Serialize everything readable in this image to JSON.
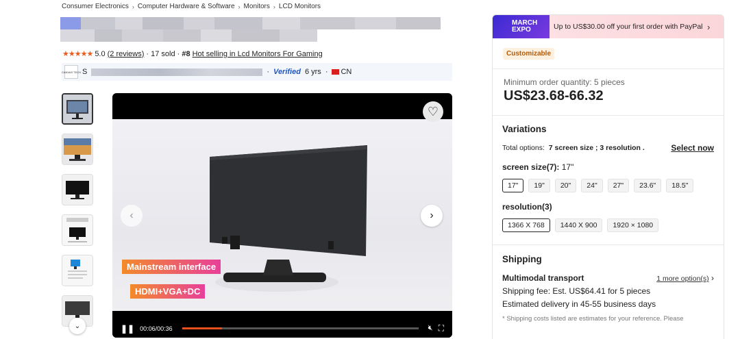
{
  "breadcrumb": [
    "Consumer Electronics",
    "Computer Hardware & Software",
    "Monitors",
    "LCD Monitors"
  ],
  "rating": {
    "score": "5.0",
    "reviews": "(2 reviews)",
    "sold": "· 17 sold ·",
    "rank": "#8",
    "rank_link": "Hot selling in Lcd Monitors For Gaming"
  },
  "supplier": {
    "logo_text": "CANVAS TECH",
    "initial": "S",
    "verified": "Verified",
    "years": "6 yrs",
    "country": "CN"
  },
  "media": {
    "tag1": "Mainstream interface",
    "tag2": "HDMI+VGA+DC",
    "time": "00:06/00:36",
    "progress": 0.17
  },
  "panel": {
    "promo_badge": "MARCH EXPO",
    "promo_text": "Up to US$30.00 off your first order with PayPal",
    "customizable": "Customizable",
    "moq": "Minimum order quantity: 5 pieces",
    "price": "US$23.68-66.32",
    "variations_title": "Variations",
    "total_prefix": "Total options:",
    "total_options": "7 screen size ; 3 resolution .",
    "select_now": "Select now",
    "screen_label": "screen size(7):",
    "screen_value": "17\"",
    "screen_sizes": [
      "17\"",
      "19\"",
      "20\"",
      "24\"",
      "27\"",
      "23.6\"",
      "18.5\""
    ],
    "resolution_label": "resolution(3)",
    "resolutions": [
      "1366 X 768",
      "1440 X 900",
      "1920 × 1080"
    ],
    "shipping_title": "Shipping",
    "transport": "Multimodal transport",
    "more_options": "1 more option(s)",
    "shipping_fee": "Shipping fee: Est. US$64.41 for 5 pieces",
    "delivery": "Estimated delivery in 45-55 business days",
    "note": "* Shipping costs listed are estimates for your reference. Please"
  },
  "colors": {
    "accent": "#e8501e",
    "verified": "#1f57c9",
    "promo_bg": "#fde3e6"
  }
}
